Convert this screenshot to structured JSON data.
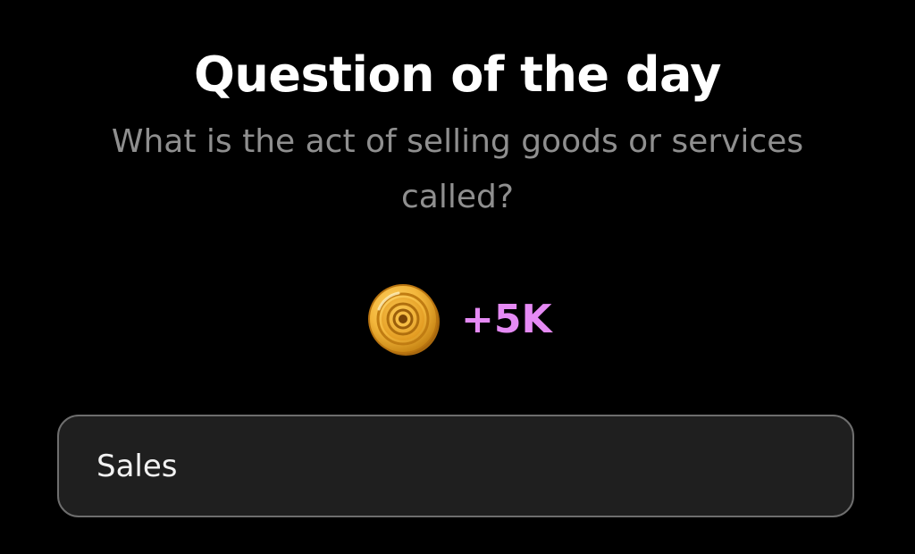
{
  "header": {
    "title": "Question of the day"
  },
  "question": {
    "text": "What is the act of selling goods or services called?"
  },
  "reward": {
    "icon": "coin-icon",
    "amount": "+5K",
    "amount_color": "#e58af4"
  },
  "answers": [
    {
      "label": "Sales"
    }
  ],
  "colors": {
    "background": "#000000",
    "title": "#ffffff",
    "question": "#8f8f8f",
    "answer_background": "#1f1f1f",
    "answer_border": "#6e6e6e",
    "coin_gold": "#f2b53a"
  }
}
